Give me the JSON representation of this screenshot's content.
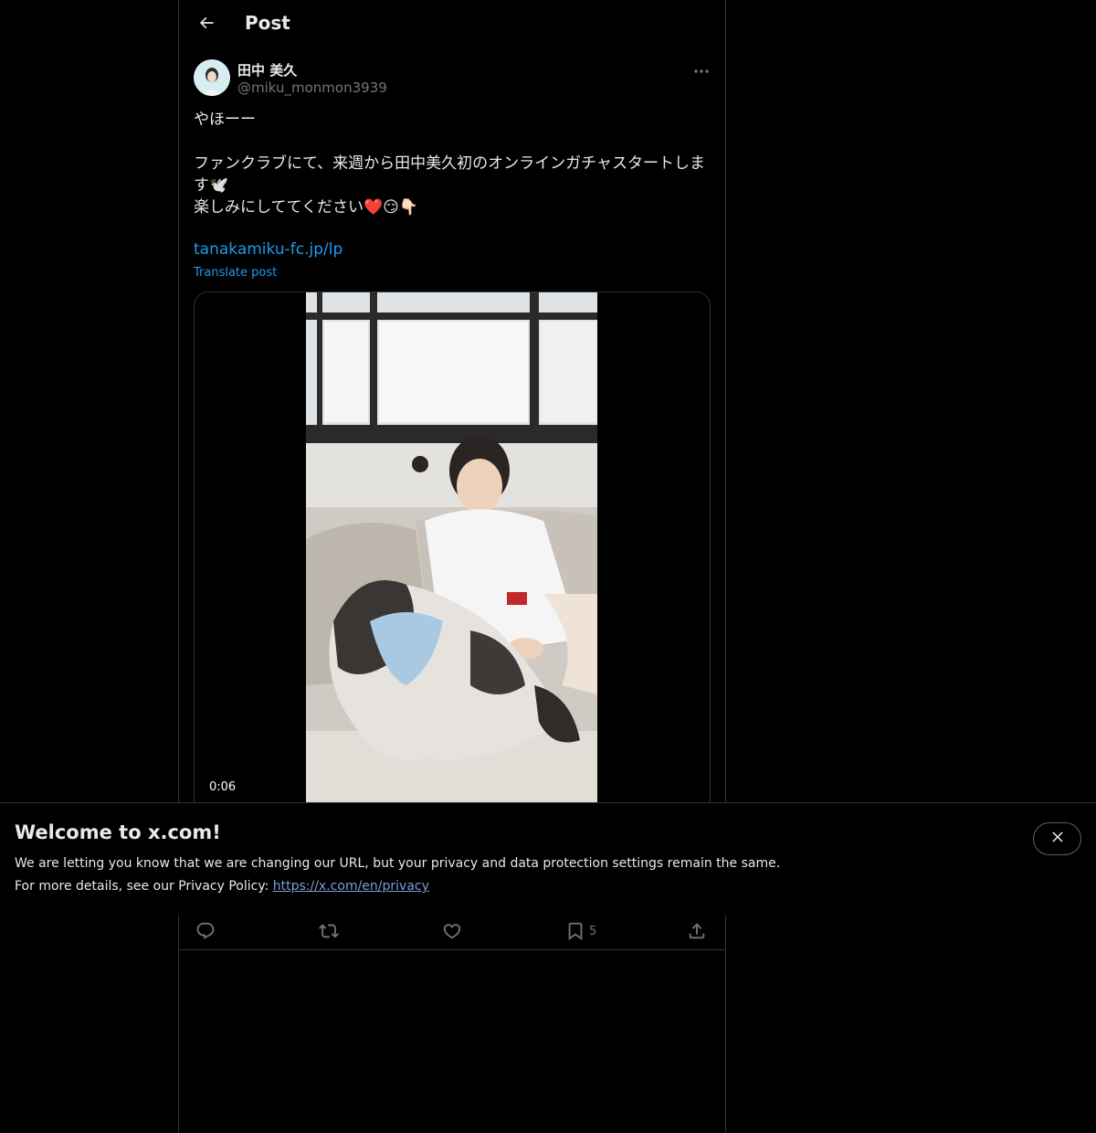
{
  "header": {
    "title": "Post",
    "back_icon": "arrow-left-icon"
  },
  "author": {
    "display_name": "田中 美久",
    "handle": "@miku_monmon3939"
  },
  "tweet": {
    "text": "やほーー\n\nファンクラブにて、来週から田中美久初のオンラインガチャスタートしま\nす🕊️\n楽しみにしててください❤️😏👇🏻",
    "link": "tanakamiku-fc.jp/lp",
    "translate_label": "Translate post"
  },
  "media": {
    "duration": "0:06"
  },
  "banner": {
    "title": "Welcome to x.com!",
    "line1": "We are letting you know that we are changing our URL, but your privacy and data protection settings remain the same.",
    "line2_prefix": "For more details, see our Privacy Policy: ",
    "line2_link": "https://x.com/en/privacy"
  },
  "actions": {
    "reply_icon": "reply-icon",
    "retweet_icon": "retweet-icon",
    "like_icon": "heart-icon",
    "bookmark_icon": "bookmark-icon",
    "bookmark_count": "5",
    "share_icon": "share-icon"
  },
  "colors": {
    "background": "#000000",
    "text": "#e7e9ea",
    "secondary_text": "#71767b",
    "accent": "#1d9bf0",
    "border": "#2f3336"
  }
}
